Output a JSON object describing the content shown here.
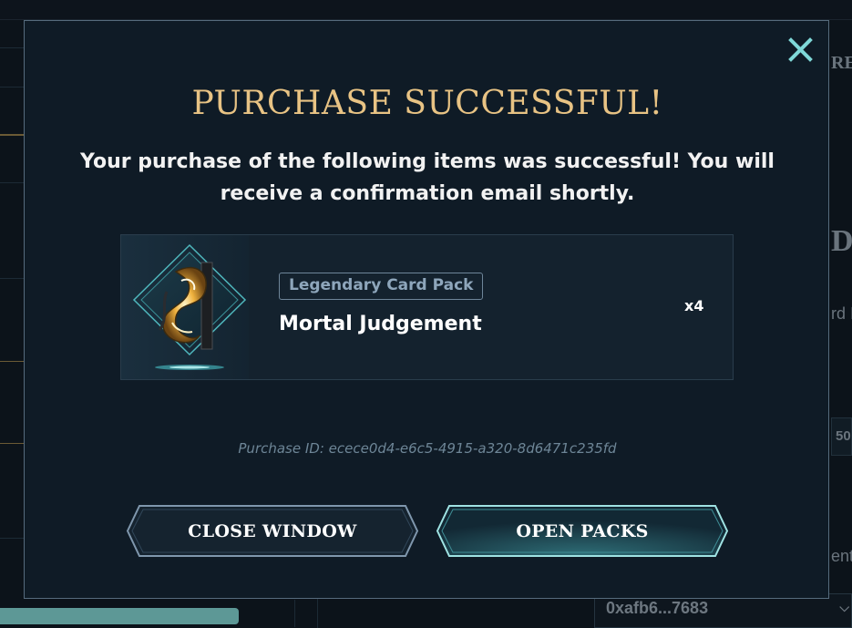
{
  "background": {
    "right_partial_text_1": "RE",
    "right_partial_text_2": "D I",
    "right_partial_text_3": "rd I",
    "right_partial_text_4": "ent",
    "right_partial_number": "50",
    "wallet_address": "0xafb6...7683",
    "progress_fraction": 0.28
  },
  "modal": {
    "title": "PURCHASE SUCCESSFUL!",
    "message": "Your purchase of the following items was successful! You will receive a confirmation email shortly.",
    "close_icon": "close-icon",
    "item": {
      "type_label": "Legendary Card Pack",
      "name": "Mortal Judgement",
      "quantity": "x4"
    },
    "purchase_id": "Purchase ID: ecece0d4-e6c5-4915-a320-8d6471c235fd",
    "buttons": {
      "close_window": "CLOSE WINDOW",
      "open_packs": "OPEN PACKS"
    }
  },
  "colors": {
    "title_gold": "#e8c384",
    "accent_cyan": "#7fd8d8",
    "modal_bg": "#0f1b26",
    "button_border_close": "#7f97ad",
    "button_border_open": "#9fe3e3"
  }
}
